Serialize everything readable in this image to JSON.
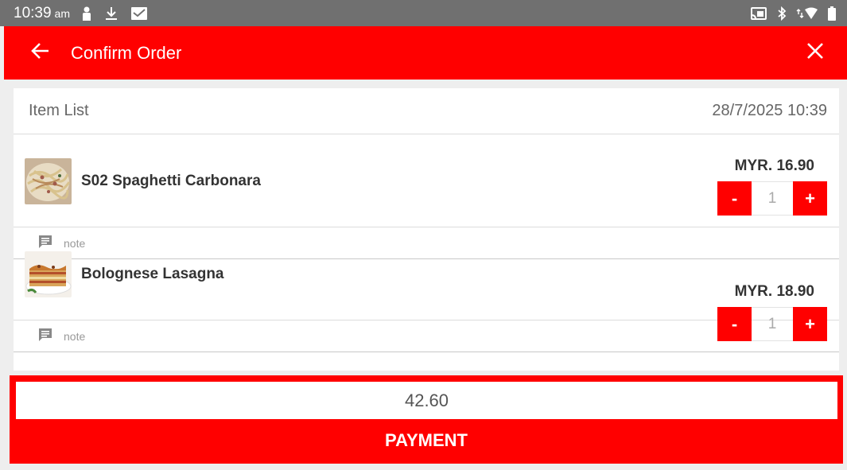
{
  "status_bar": {
    "time": "10:39",
    "ampm": "am",
    "left_icons": [
      "person-icon",
      "download-icon",
      "mail-icon"
    ],
    "right_icons": [
      "cast-icon",
      "bluetooth-icon",
      "wifi-icon",
      "battery-icon"
    ]
  },
  "appbar": {
    "title": "Confirm Order",
    "back_icon": "arrow-left-icon",
    "close_icon": "close-icon",
    "color": "#ff0000"
  },
  "list": {
    "header_label": "Item List",
    "datetime": "28/7/2025 10:39",
    "items": [
      {
        "name": "S02 Spaghetti Carbonara",
        "price": "MYR. 16.90",
        "quantity": "1",
        "minus_label": "-",
        "plus_label": "+",
        "note_placeholder": "note"
      },
      {
        "name": "Bolognese Lasagna",
        "price": "MYR. 18.90",
        "quantity": "1",
        "minus_label": "-",
        "plus_label": "+",
        "note_placeholder": "note"
      }
    ]
  },
  "footer": {
    "total": "42.60",
    "payment_label": "PAYMENT"
  }
}
